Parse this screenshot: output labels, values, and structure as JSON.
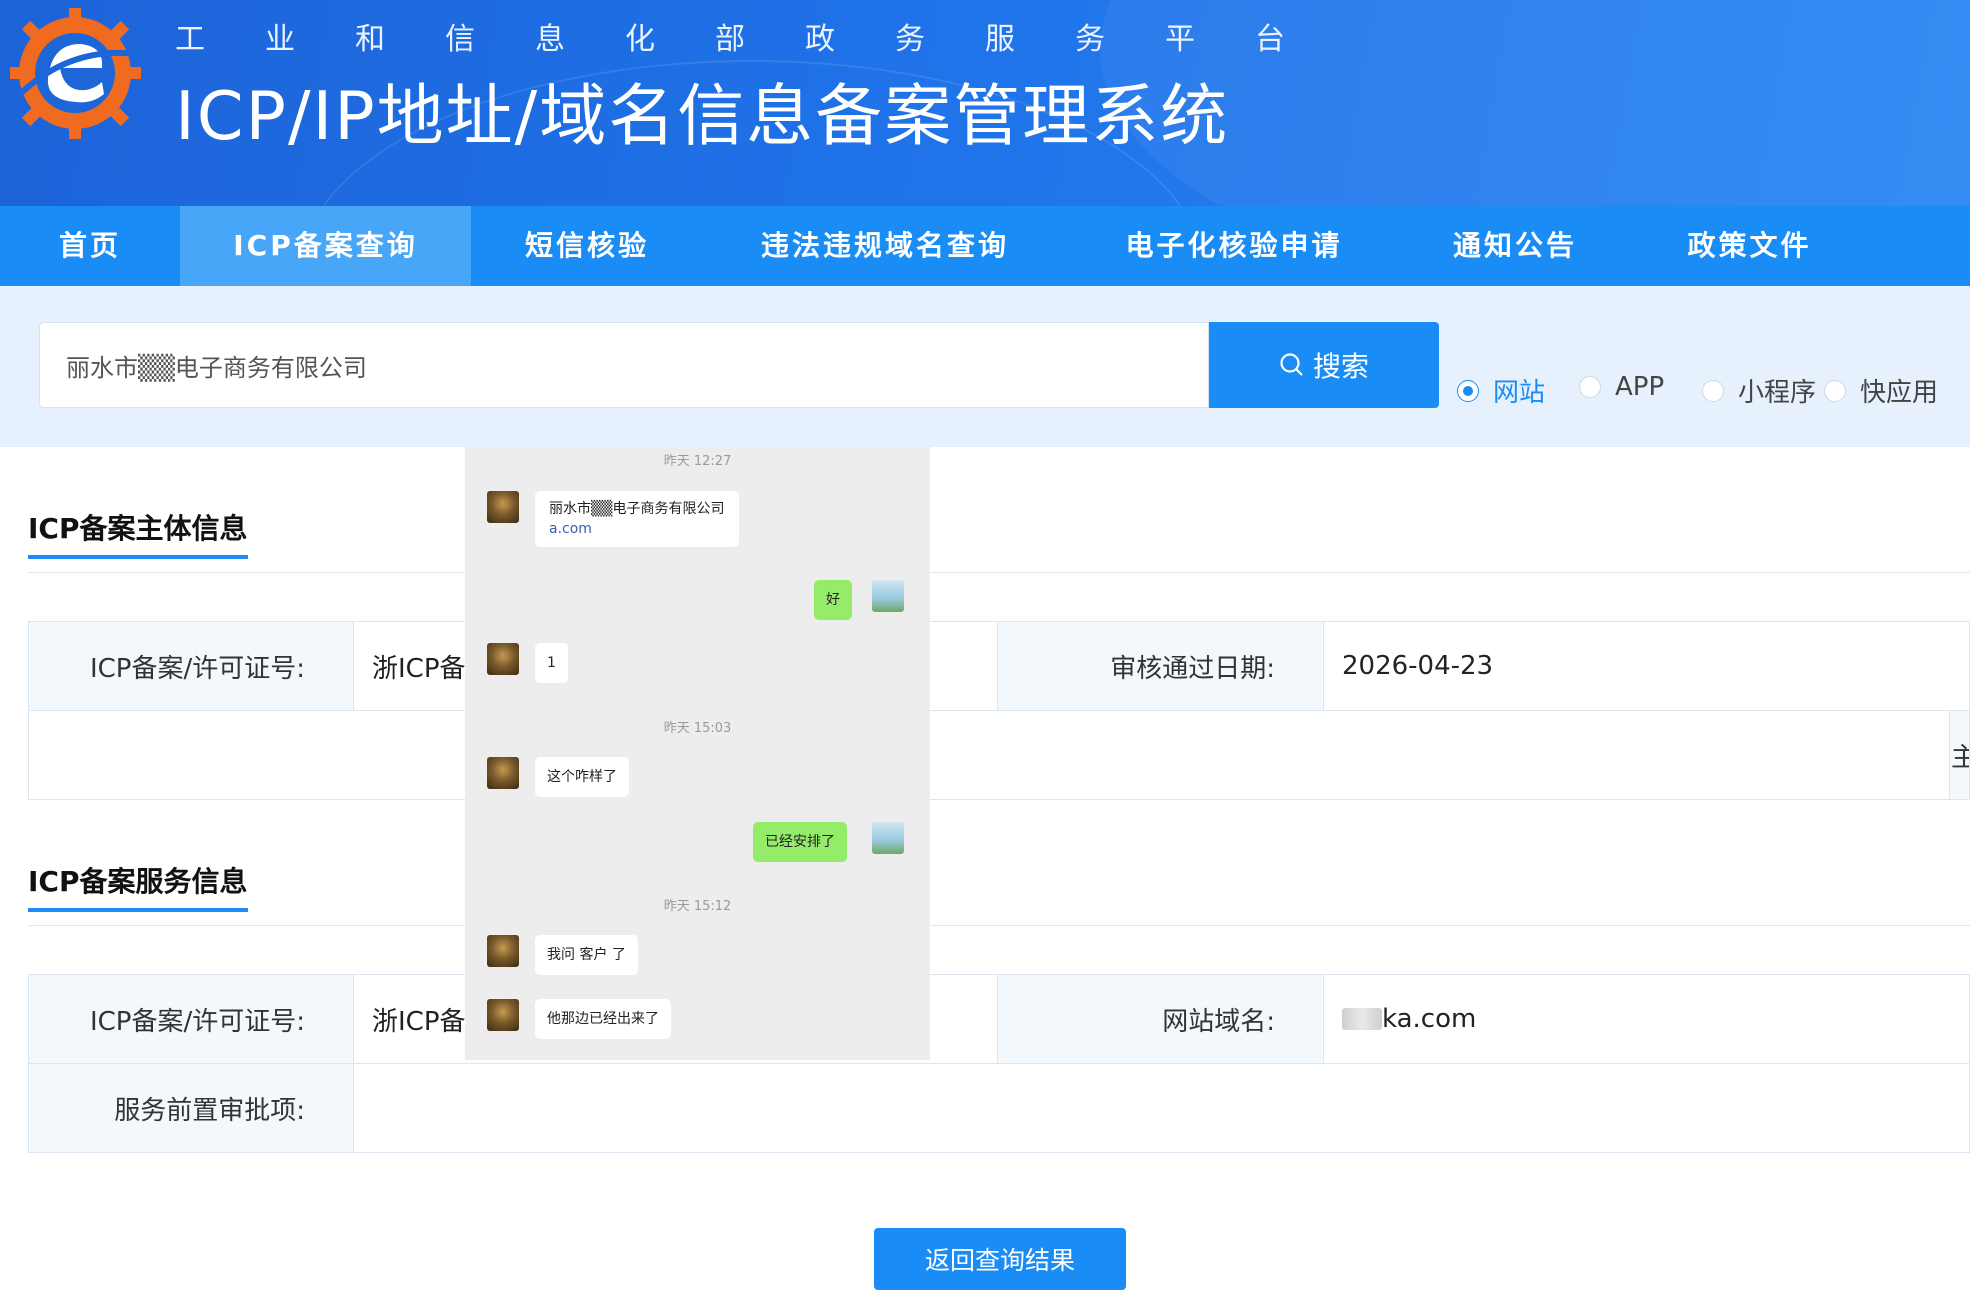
{
  "header": {
    "subtitle_chars": [
      "工",
      "业",
      "和",
      "信",
      "息",
      "化",
      "部",
      "政",
      "务",
      "服",
      "务",
      "平",
      "台"
    ],
    "title": "ICP/IP地址/域名信息备案管理系统"
  },
  "nav": {
    "items": [
      "首页",
      "ICP备案查询",
      "短信核验",
      "违法违规域名查询",
      "电子化核验申请",
      "通知公告",
      "政策文件"
    ],
    "active": "ICP备案查询"
  },
  "search": {
    "value": "丽水市▒▒电子商务有限公司",
    "button_label": "搜索",
    "types": [
      "网站",
      "APP",
      "小程序",
      "快应用"
    ],
    "selected": "网站"
  },
  "section_main": {
    "title": "ICP备案主体信息",
    "license_label": "ICP备案/许可证号:",
    "license_value": "浙ICP备",
    "date_label": "审核通过日期:",
    "date_value": "2026-04-23",
    "row2_right_fragment": "主"
  },
  "section_service": {
    "title": "ICP备案服务信息",
    "license_label": "ICP备案/许可证号:",
    "license_value": "浙ICP备",
    "domain_label": "网站域名:",
    "domain_value": "ka.com",
    "preapproval_label": "服务前置审批项:"
  },
  "back_button": "返回查询结果",
  "chat": {
    "time1": "昨天 12:27",
    "msg1_line1": "丽水市▒▒电子商务有限公司",
    "msg1_line2": "a.com",
    "msg2": "好",
    "msg3": "1",
    "time2": "昨天 15:03",
    "msg4": "这个咋样了",
    "msg5": "已经安排了",
    "time3": "昨天 15:12",
    "msg6": "我问 客户 了",
    "msg7": "他那边已经出来了"
  },
  "colors": {
    "header_blue": "#1f6fe5",
    "nav_blue": "#1a8cf5",
    "nav_active": "#47a6f7",
    "search_bg": "#e6f1fd",
    "bubble_green": "#95ec69"
  }
}
